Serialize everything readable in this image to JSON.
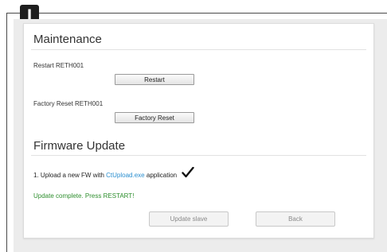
{
  "badge": {
    "label": "I"
  },
  "maintenance": {
    "title": "Maintenance",
    "restart": {
      "label": "Restart RETH001",
      "button": "Restart"
    },
    "factory_reset": {
      "label": "Factory Reset RETH001",
      "button": "Factory Reset"
    }
  },
  "firmware": {
    "title": "Firmware Update",
    "step_prefix": "1. Upload a new FW with ",
    "step_link": "CtUpload.exe",
    "step_suffix": " application",
    "status": "Update complete. Press RESTART!",
    "update_slave_button": "Update slave",
    "back_button": "Back"
  },
  "icons": {
    "step_done": "checkmark-icon"
  },
  "colors": {
    "link": "#2a8fd0",
    "success": "#2f8f2f",
    "badge": "#1e1e1e"
  }
}
